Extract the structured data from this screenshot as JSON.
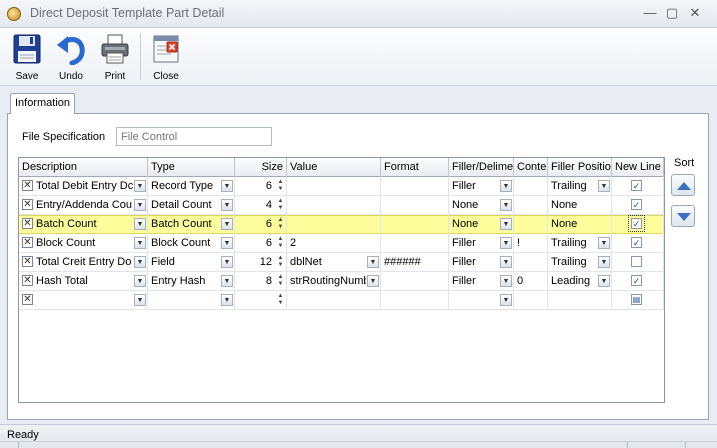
{
  "window": {
    "title": "Direct Deposit Template Part Detail"
  },
  "toolbar": {
    "save": "Save",
    "undo": "Undo",
    "print": "Print",
    "close": "Close"
  },
  "tabs": {
    "information": "Information"
  },
  "file_spec": {
    "label": "File Specification",
    "placeholder": "File Control"
  },
  "grid": {
    "headers": {
      "description": "Description",
      "type": "Type",
      "size": "Size",
      "value": "Value",
      "format": "Format",
      "filler": "Filler/Delimet",
      "content": "Conter",
      "filler_position": "Filler Position",
      "new_line": "New Line"
    },
    "rows": [
      {
        "description": "Total Debit Entry Dc",
        "type": "Record Type",
        "size": "6",
        "value": "",
        "format": "",
        "filler": "Filler",
        "content": "",
        "filler_position": "Trailing",
        "new_line": true
      },
      {
        "description": "Entry/Addenda Cou",
        "type": "Detail Count",
        "size": "4",
        "value": "",
        "format": "",
        "filler": "None",
        "content": "",
        "filler_position": "None",
        "new_line": true
      },
      {
        "description": "Batch Count",
        "type": "Batch Count",
        "size": "6",
        "value": "",
        "format": "",
        "filler": "None",
        "content": "",
        "filler_position": "None",
        "new_line": true
      },
      {
        "description": "Block Count",
        "type": "Block Count",
        "size": "6",
        "value": "2",
        "format": "",
        "filler": "Filler",
        "content": "!",
        "filler_position": "Trailing",
        "new_line": true
      },
      {
        "description": "Total Creit Entry Do",
        "type": "Field",
        "size": "12",
        "value": "dblNet",
        "format": "######",
        "filler": "Filler",
        "content": "",
        "filler_position": "Trailing",
        "new_line": false
      },
      {
        "description": "Hash Total",
        "type": "Entry Hash",
        "size": "8",
        "value": "strRoutingNumb",
        "format": "",
        "filler": "Filler",
        "content": "0",
        "filler_position": "Leading",
        "new_line": true
      },
      {
        "description": "",
        "type": "",
        "size": "",
        "value": "",
        "format": "",
        "filler": "",
        "content": "",
        "filler_position": "",
        "new_line": false
      }
    ]
  },
  "sort": {
    "label": "Sort"
  },
  "status": {
    "text": "Ready"
  },
  "colors": {
    "selected_row": "#fefe9c",
    "accent": "#2f6fcf"
  }
}
